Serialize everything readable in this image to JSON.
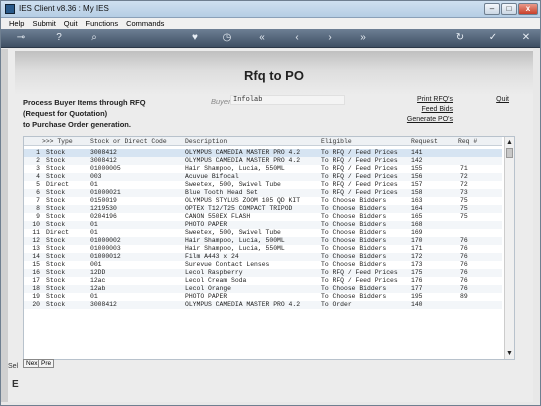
{
  "window": {
    "title": "IES Client v8.36 : My IES"
  },
  "title_buttons": {
    "min": "–",
    "max": "□",
    "close": "x"
  },
  "menu": [
    "Help",
    "Submit",
    "Quit",
    "Functions",
    "Commands"
  ],
  "toolbar": {
    "icons": [
      "key-icon",
      "help-icon",
      "search-icon",
      "heart-icon",
      "clock-icon",
      "rewind-icon",
      "back-icon",
      "forward-icon",
      "fast-forward-icon",
      "refresh-icon",
      "check-icon",
      "close-icon"
    ],
    "glyphs": [
      "⊸",
      "?",
      "⌕",
      "♥",
      "◷",
      "«",
      "‹",
      "›",
      "»",
      "↻",
      "✓",
      "✕"
    ]
  },
  "page": {
    "title": "Rfq to PO",
    "description": [
      "Process Buyer Items through RFQ",
      "(Request for Quotation)",
      "to Purchase Order generation."
    ],
    "buyer_label": "Buyer",
    "buyer_value": "Infolab",
    "links": {
      "print_rfqs": "Print RFQ's",
      "feed_bids": "Feed Bids",
      "generate_pos": "Generate PO's",
      "quit": "Quit"
    }
  },
  "grid": {
    "headers": [
      ">>> Type",
      "Stock or Direct Code",
      "Description",
      "Eligible",
      "Request",
      "Req #"
    ],
    "rows": [
      [
        "1",
        "Stock",
        "3008412",
        "OLYMPUS CAMEDIA MASTER PRO 4.2",
        "To RFQ / Feed Prices",
        "141",
        ""
      ],
      [
        "2",
        "Stock",
        "3008412",
        "OLYMPUS CAMEDIA MASTER PRO 4.2",
        "To RFQ / Feed Prices",
        "142",
        ""
      ],
      [
        "3",
        "Stock",
        "01000005",
        "Hair Shampoo, Lucia, 550ML",
        "To RFQ / Feed Prices",
        "155",
        "71"
      ],
      [
        "4",
        "Stock",
        "003",
        "Acuvue Bifocal",
        "To RFQ / Feed Prices",
        "156",
        "72"
      ],
      [
        "5",
        "Direct",
        "01",
        "Sweetex, 500, Swivel Tube",
        "To RFQ / Feed Prices",
        "157",
        "72"
      ],
      [
        "6",
        "Stock",
        "01000021",
        "Blue Tooth Head Set",
        "To RFQ / Feed Prices",
        "158",
        "73"
      ],
      [
        "7",
        "Stock",
        "0150019",
        "OLYMPUS STYLUS ZOOM 105 QD KIT",
        "To Choose Bidders",
        "163",
        "75"
      ],
      [
        "8",
        "Stock",
        "1219530",
        "OPTEX T12/T25 COMPACT TRIPOD",
        "To Choose Bidders",
        "164",
        "75"
      ],
      [
        "9",
        "Stock",
        "0204196",
        "CANON 550EX FLASH",
        "To Choose Bidders",
        "165",
        "75"
      ],
      [
        "10",
        "Stock",
        "01",
        "PHOTO PAPER",
        "To Choose Bidders",
        "168",
        ""
      ],
      [
        "11",
        "Direct",
        "01",
        "Sweetex, 500, Swivel Tube",
        "To Choose Bidders",
        "169",
        ""
      ],
      [
        "12",
        "Stock",
        "01000002",
        "Hair Shampoo, Lucia, 500ML",
        "To Choose Bidders",
        "170",
        "76"
      ],
      [
        "13",
        "Stock",
        "01000003",
        "Hair Shampoo, Lucia, 550ML",
        "To Choose Bidders",
        "171",
        "76"
      ],
      [
        "14",
        "Stock",
        "01000012",
        "Film A443 x 24",
        "To Choose Bidders",
        "172",
        "76"
      ],
      [
        "15",
        "Stock",
        "001",
        "Surevue Contact Lenses",
        "To Choose Bidders",
        "173",
        "76"
      ],
      [
        "16",
        "Stock",
        "12DD",
        "Lecol Raspberry",
        "To RFQ / Feed Prices",
        "175",
        "76"
      ],
      [
        "17",
        "Stock",
        "12ac",
        "Lecol Cream Soda",
        "To RFQ / Feed Prices",
        "176",
        "76"
      ],
      [
        "18",
        "Stock",
        "12ab",
        "Lecol Orange",
        "To Choose Bidders",
        "177",
        "76"
      ],
      [
        "19",
        "Stock",
        "01",
        "PHOTO PAPER",
        "To Choose Bidders",
        "195",
        "89"
      ],
      [
        "20",
        "Stock",
        "3008412",
        "OLYMPUS CAMEDIA MASTER PRO 4.2",
        "To Order",
        "140",
        ""
      ]
    ]
  },
  "scroll": {
    "up": "▲",
    "down": "▼"
  },
  "nav": {
    "next": "Nex",
    "prev": "Pre"
  },
  "bottom": {
    "sel": "Sel",
    "e": "E"
  }
}
